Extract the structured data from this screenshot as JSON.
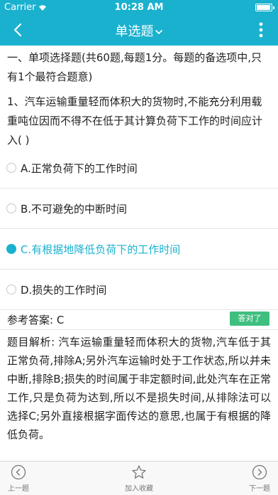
{
  "status_bar": {
    "carrier": "Carrier",
    "time": "10:28 AM"
  },
  "nav": {
    "title": "单选题",
    "back_icon": "chevron-left-icon",
    "more_icon": "vertical-dots-icon"
  },
  "intro": "一、单项选择题(共60题,每题1分。每题的备选项中,只有1个最符合题意)",
  "question": "1、汽车运输重量轻而体积大的货物时,不能充分利用载重吨位因而不得不在低于其计算负荷下工作的时间应计入(    )",
  "options": [
    {
      "label": "A.正常负荷下的工作时间",
      "selected": false
    },
    {
      "label": "B.不可避免的中断时间",
      "selected": false
    },
    {
      "label": "C.有根据地降低负荷下的工作时间",
      "selected": true
    },
    {
      "label": "D.损失的工作时间",
      "selected": false
    }
  ],
  "answer": {
    "text": "参考答案: C",
    "badge": "答对了"
  },
  "analysis": "题目解析: 汽车运输重量轻而体积大的货物,汽车低于其正常负荷,排除A;另外汽车运输时处于工作状态,所以并未中断,排除B;损失的时间属于非定额时间,此处汽车在正常工作,只是负荷为达到,所以不是损失时间,从排除法可以选择C;另外直接根据字面传达的意思,也属于有根据的降低负荷。",
  "tabs": {
    "prev": "上一题",
    "favorite": "加入收藏",
    "next": "下一题"
  },
  "colors": {
    "primary": "#1ab1ce",
    "correct_badge": "#3ebf7f"
  }
}
